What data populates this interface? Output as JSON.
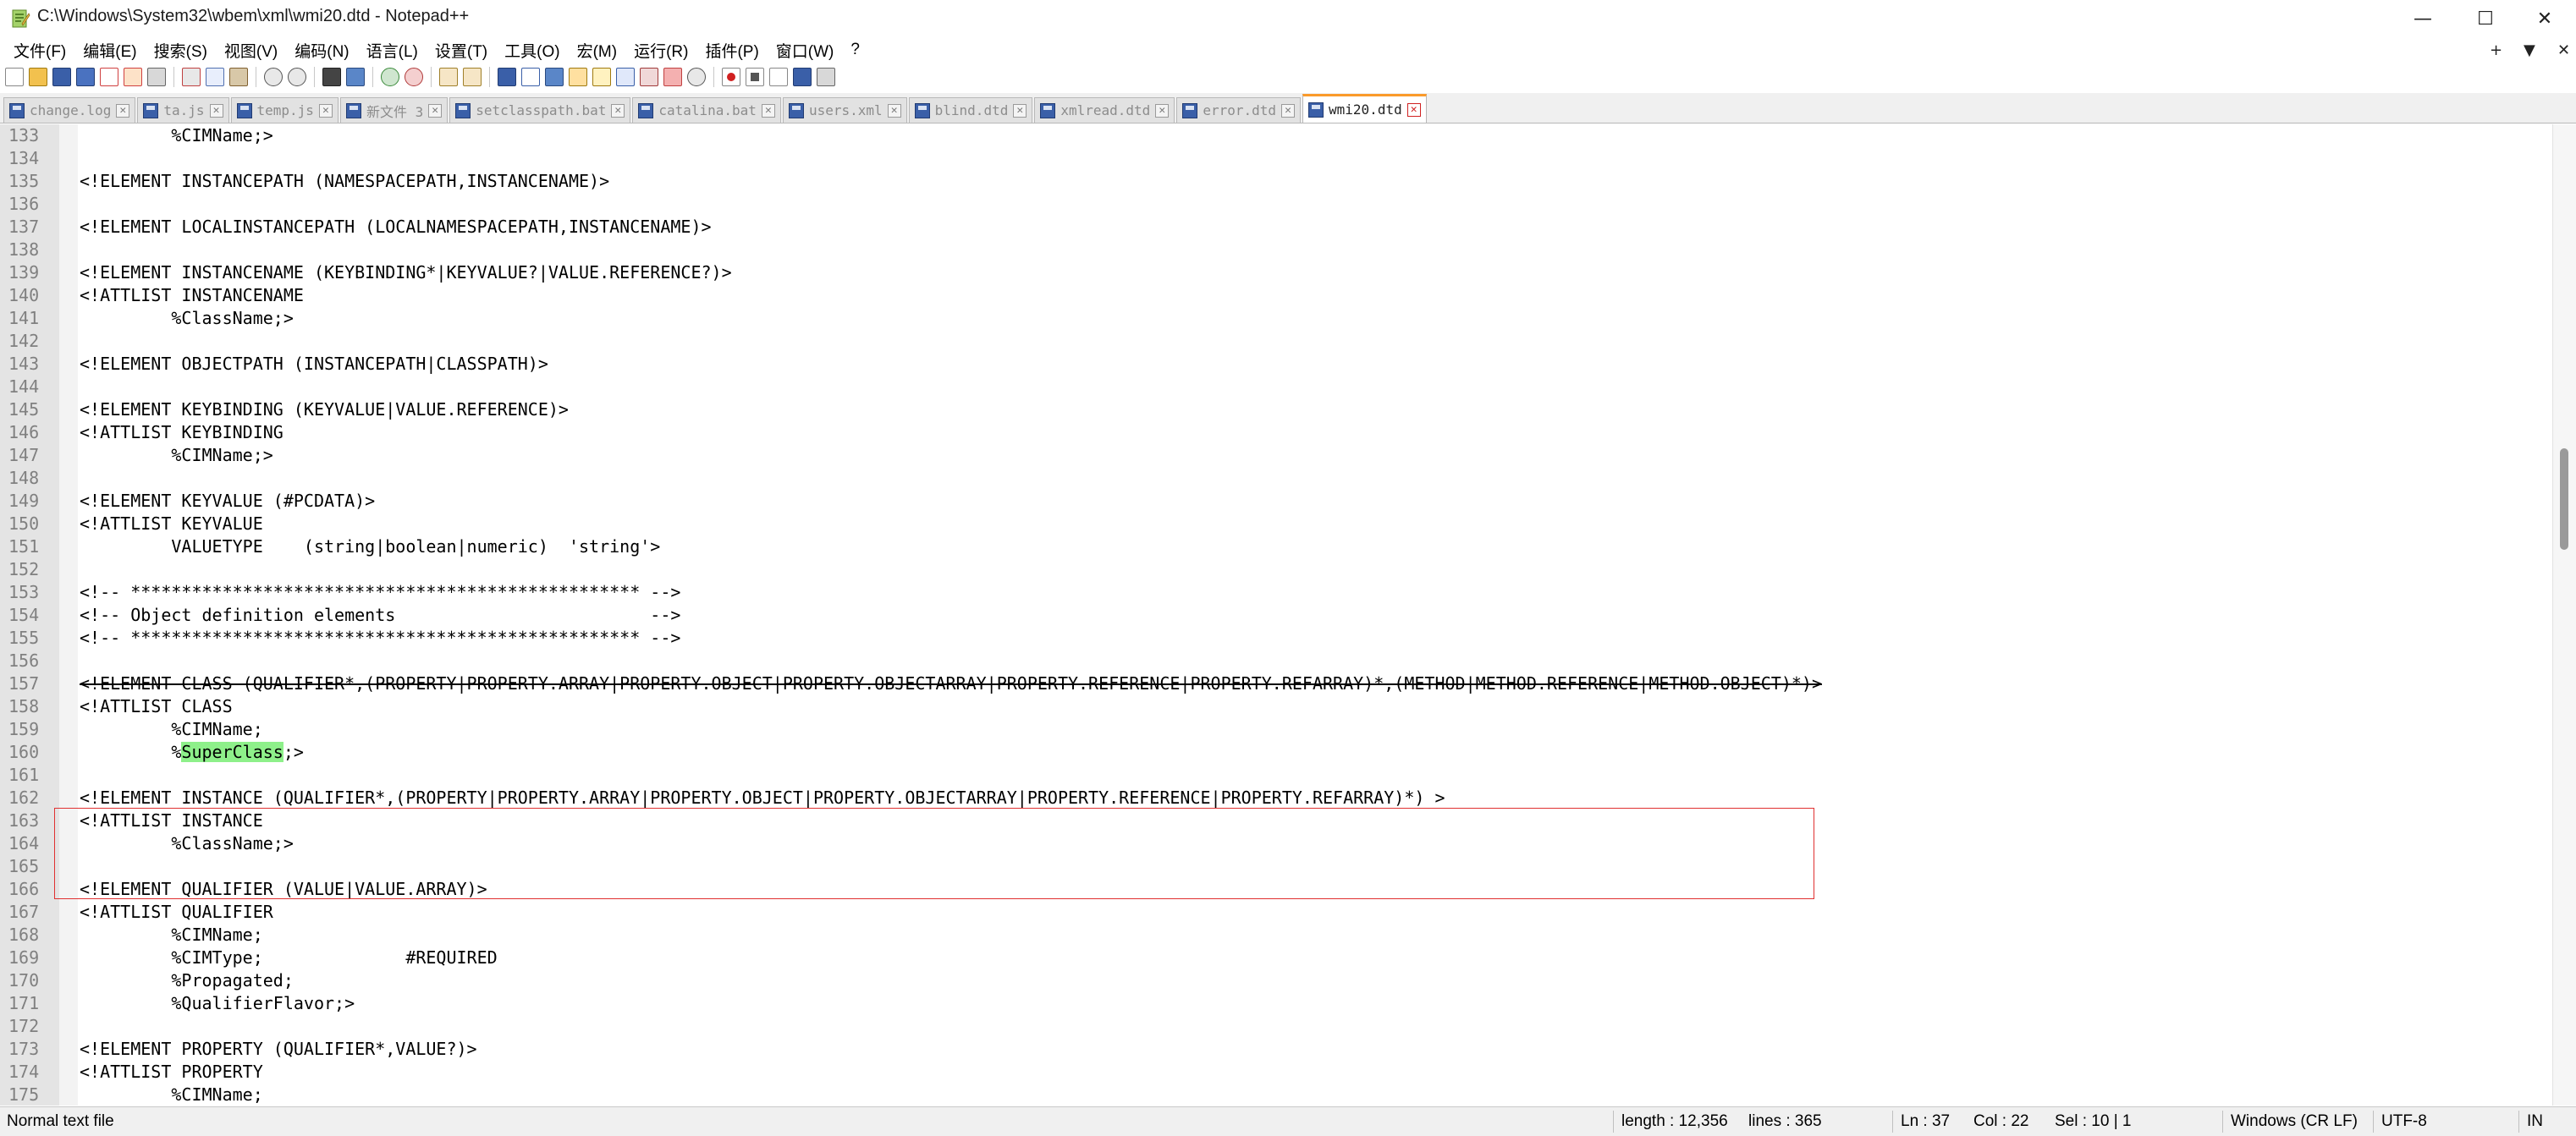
{
  "window": {
    "title": "C:\\Windows\\System32\\wbem\\xml\\wmi20.dtd - Notepad++",
    "minimize": "—",
    "maximize": "☐",
    "close": "✕"
  },
  "menu": {
    "items": [
      "文件(F)",
      "编辑(E)",
      "搜索(S)",
      "视图(V)",
      "编码(N)",
      "语言(L)",
      "设置(T)",
      "工具(O)",
      "宏(M)",
      "运行(R)",
      "插件(P)",
      "窗口(W)",
      "?"
    ],
    "right_plus": "+",
    "right_down": "▼",
    "right_close": "✕"
  },
  "tabs": [
    {
      "label": "change.log",
      "active": false
    },
    {
      "label": "ta.js",
      "active": false
    },
    {
      "label": "temp.js",
      "active": false
    },
    {
      "label": "新文件 3",
      "active": false
    },
    {
      "label": "setclasspath.bat",
      "active": false
    },
    {
      "label": "catalina.bat",
      "active": false
    },
    {
      "label": "users.xml",
      "active": false
    },
    {
      "label": "blind.dtd",
      "active": false
    },
    {
      "label": "xmlread.dtd",
      "active": false
    },
    {
      "label": "error.dtd",
      "active": false
    },
    {
      "label": "wmi20.dtd",
      "active": true
    }
  ],
  "editor": {
    "lines": [
      {
        "n": "133",
        "t": "         %CIMName;>"
      },
      {
        "n": "134",
        "t": ""
      },
      {
        "n": "135",
        "t": "<!ELEMENT INSTANCEPATH (NAMESPACEPATH,INSTANCENAME)>"
      },
      {
        "n": "136",
        "t": ""
      },
      {
        "n": "137",
        "t": "<!ELEMENT LOCALINSTANCEPATH (LOCALNAMESPACEPATH,INSTANCENAME)>"
      },
      {
        "n": "138",
        "t": ""
      },
      {
        "n": "139",
        "t": "<!ELEMENT INSTANCENAME (KEYBINDING*|KEYVALUE?|VALUE.REFERENCE?)>"
      },
      {
        "n": "140",
        "t": "<!ATTLIST INSTANCENAME"
      },
      {
        "n": "141",
        "t": "         %ClassName;>"
      },
      {
        "n": "142",
        "t": ""
      },
      {
        "n": "143",
        "t": "<!ELEMENT OBJECTPATH (INSTANCEPATH|CLASSPATH)>"
      },
      {
        "n": "144",
        "t": ""
      },
      {
        "n": "145",
        "t": "<!ELEMENT KEYBINDING (KEYVALUE|VALUE.REFERENCE)>"
      },
      {
        "n": "146",
        "t": "<!ATTLIST KEYBINDING"
      },
      {
        "n": "147",
        "t": "         %CIMName;>"
      },
      {
        "n": "148",
        "t": ""
      },
      {
        "n": "149",
        "t": "<!ELEMENT KEYVALUE (#PCDATA)>"
      },
      {
        "n": "150",
        "t": "<!ATTLIST KEYVALUE"
      },
      {
        "n": "151",
        "t": "         VALUETYPE    (string|boolean|numeric)  'string'>"
      },
      {
        "n": "152",
        "t": ""
      },
      {
        "n": "153",
        "t": "<!-- ************************************************** -->"
      },
      {
        "n": "154",
        "t": "<!-- Object definition elements                         -->"
      },
      {
        "n": "155",
        "t": "<!-- ************************************************** -->"
      },
      {
        "n": "156",
        "t": ""
      },
      {
        "n": "157",
        "t": "<!ELEMENT CLASS (QUALIFIER*,(PROPERTY|PROPERTY.ARRAY|PROPERTY.OBJECT|PROPERTY.OBJECTARRAY|PROPERTY.REFERENCE|PROPERTY.REFARRAY)*,(METHOD|METHOD.REFERENCE|METHOD.OBJECT)*)>"
      },
      {
        "n": "158",
        "t": "<!ATTLIST CLASS"
      },
      {
        "n": "159",
        "t": "         %CIMName;"
      },
      {
        "n": "160",
        "t_pre": "         %",
        "t_hl": "SuperClass",
        "t_post": ";>"
      },
      {
        "n": "161",
        "t": ""
      },
      {
        "n": "162",
        "t": "<!ELEMENT INSTANCE (QUALIFIER*,(PROPERTY|PROPERTY.ARRAY|PROPERTY.OBJECT|PROPERTY.OBJECTARRAY|PROPERTY.REFERENCE|PROPERTY.REFARRAY)*) >"
      },
      {
        "n": "163",
        "t": "<!ATTLIST INSTANCE"
      },
      {
        "n": "164",
        "t": "         %ClassName;>"
      },
      {
        "n": "165",
        "t": ""
      },
      {
        "n": "166",
        "t": "<!ELEMENT QUALIFIER (VALUE|VALUE.ARRAY)>"
      },
      {
        "n": "167",
        "t": "<!ATTLIST QUALIFIER"
      },
      {
        "n": "168",
        "t": "         %CIMName;"
      },
      {
        "n": "169",
        "t": "         %CIMType;              #REQUIRED"
      },
      {
        "n": "170",
        "t": "         %Propagated;"
      },
      {
        "n": "171",
        "t": "         %QualifierFlavor;>"
      },
      {
        "n": "172",
        "t": ""
      },
      {
        "n": "173",
        "t": "<!ELEMENT PROPERTY (QUALIFIER*,VALUE?)>"
      },
      {
        "n": "174",
        "t": "<!ATTLIST PROPERTY"
      },
      {
        "n": "175",
        "t": "         %CIMName;"
      }
    ]
  },
  "status": {
    "file_type": "Normal text file",
    "length": "length : 12,356",
    "lines": "lines : 365",
    "ln": "Ln : 37",
    "col": "Col : 22",
    "sel": "Sel : 10 | 1",
    "eol": "Windows (CR LF)",
    "encoding": "UTF-8",
    "mode": "IN"
  },
  "colors": {
    "tab_active_accent": "#fa9a2a",
    "highlight": "#8ef08a",
    "selection_box": "#e03030"
  }
}
